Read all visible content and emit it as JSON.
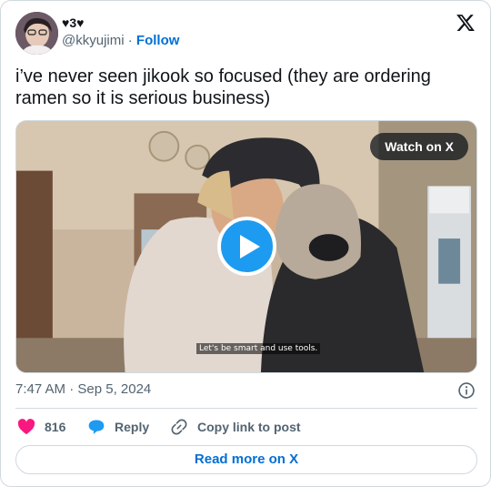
{
  "author": {
    "display_name": "♥3♥",
    "handle": "@kkyujimi",
    "separator": " · ",
    "follow_label": "Follow"
  },
  "tweet": {
    "text": "i’ve never seen jikook so focused (they are ordering ramen so it is serious business)"
  },
  "media": {
    "watch_label": "Watch on X",
    "subtitle": "Let's be smart and use tools."
  },
  "meta": {
    "timestamp": "7:47 AM · Sep 5, 2024"
  },
  "actions": {
    "like_count": "816",
    "reply_label": "Reply",
    "copy_label": "Copy link to post"
  },
  "footer": {
    "read_more_label": "Read more on X"
  },
  "colors": {
    "accent": "#1d9bf0",
    "link": "#006fd6",
    "like": "#f91880",
    "muted": "#536471",
    "border": "#cfd9de"
  },
  "icons": [
    "x-logo-icon",
    "play-icon",
    "info-icon",
    "heart-icon",
    "reply-bubble-icon",
    "link-icon"
  ]
}
